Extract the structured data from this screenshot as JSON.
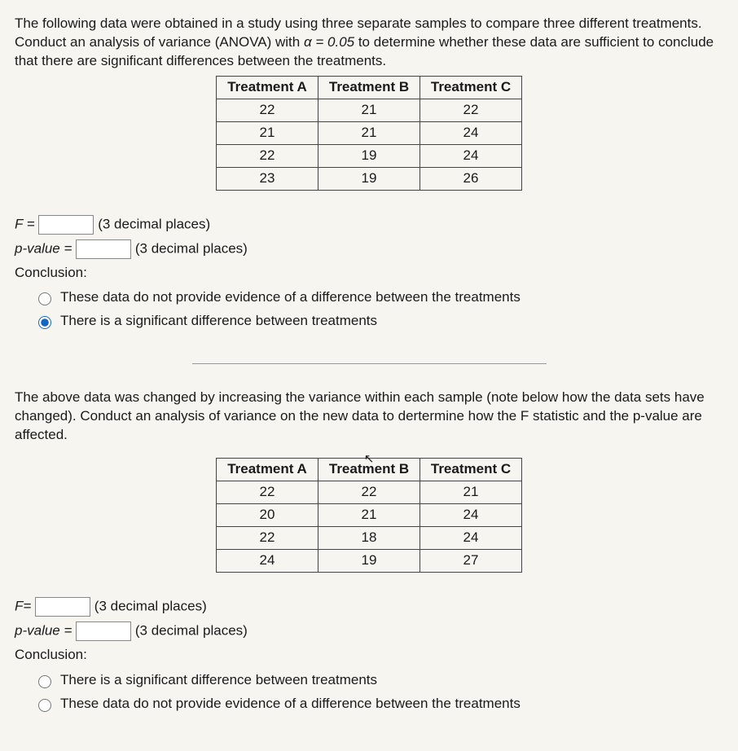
{
  "q1": {
    "prompt_a": "The following data were obtained in a study using three separate samples to compare three different treatments. Conduct an analysis of variance (ANOVA) with ",
    "alpha": "α = 0.05",
    "prompt_b": " to determine whether these data are sufficient to conclude that there are significant differences between the treatments.",
    "table": {
      "headers": [
        "Treatment A",
        "Treatment B",
        "Treatment C"
      ],
      "rows": [
        [
          "22",
          "21",
          "22"
        ],
        [
          "21",
          "21",
          "24"
        ],
        [
          "22",
          "19",
          "24"
        ],
        [
          "23",
          "19",
          "26"
        ]
      ]
    },
    "f_label": "F =",
    "f_hint": "(3 decimal places)",
    "p_label": "p-value =",
    "p_hint": "(3 decimal places)",
    "conclusion_label": "Conclusion:",
    "opt1": "These data do not provide evidence of a difference between the treatments",
    "opt2": "There is a significant difference between treatments"
  },
  "q2": {
    "prompt": "The above data was changed by increasing the variance within each sample (note below how the data sets have changed). Conduct an analysis of variance on the new data to dertermine how the F statistic and the p-value are affected.",
    "table": {
      "headers": [
        "Treatment A",
        "Treatment B",
        "Treatment C"
      ],
      "rows": [
        [
          "22",
          "22",
          "21"
        ],
        [
          "20",
          "21",
          "24"
        ],
        [
          "22",
          "18",
          "24"
        ],
        [
          "24",
          "19",
          "27"
        ]
      ]
    },
    "f_label": "F=",
    "f_hint": "(3 decimal places)",
    "p_label": "p-value =",
    "p_hint": "(3 decimal places)",
    "conclusion_label": "Conclusion:",
    "opt1": "There is a significant difference between treatments",
    "opt2": "These data do not provide evidence of a difference between the treatments"
  }
}
